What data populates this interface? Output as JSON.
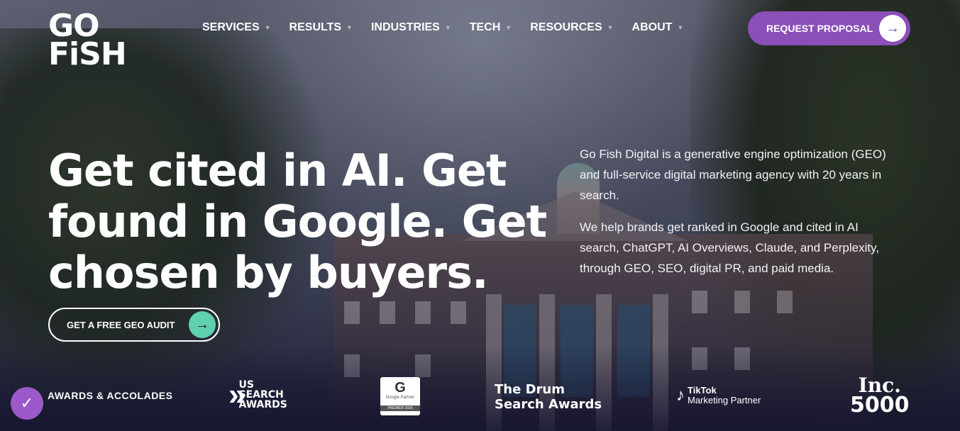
{
  "brand": {
    "logo_line1": "GO",
    "logo_line2": "FiSH"
  },
  "nav": {
    "items": [
      {
        "label": "SERVICES"
      },
      {
        "label": "RESULTS"
      },
      {
        "label": "INDUSTRIES"
      },
      {
        "label": "TECH"
      },
      {
        "label": "RESOURCES"
      },
      {
        "label": "ABOUT"
      }
    ],
    "cta_label": "REQUEST PROPOSAL"
  },
  "hero": {
    "headline": "Get cited in AI. Get found in Google. Get chosen by buyers.",
    "intro_p1": "Go Fish Digital is a generative engine optimization (GEO) and full-service digital marketing agency with 20 years in search.",
    "intro_p2": "We help brands get ranked in Google and cited in AI search, ChatGPT, AI Overviews, Claude, and Perplexity, through GEO, SEO, digital PR, and paid media.",
    "audit_button": "GET A FREE GEO AUDIT"
  },
  "awards": {
    "label": "AWARDS & ACCOLADES",
    "us_search": {
      "line1": "US",
      "line2": "SEARCH",
      "line3": "AWARDS"
    },
    "google_partner": {
      "logo": "G",
      "line1": "Google Partner",
      "line2": "PREMIER 2025"
    },
    "drum": {
      "line1": "The Drum",
      "line2": "Search Awards"
    },
    "tiktok": {
      "line1": "TikTok",
      "line2": "Marketing Partner"
    },
    "inc": {
      "line1": "Inc.",
      "line2": "5000"
    }
  },
  "colors": {
    "accent_purple": "#8b4fb8",
    "accent_teal": "#5fd0b0"
  }
}
